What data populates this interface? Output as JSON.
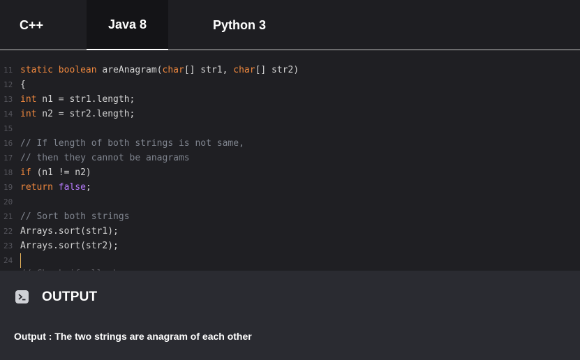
{
  "tabs": [
    {
      "label": "C++",
      "active": false
    },
    {
      "label": "Java 8",
      "active": true
    },
    {
      "label": "Python 3",
      "active": false
    }
  ],
  "editor": {
    "lines": [
      {
        "number": "11",
        "tokens": [
          {
            "t": "static boolean",
            "c": "kw"
          },
          {
            "t": " areAnagram(",
            "c": ""
          },
          {
            "t": "char",
            "c": "kw"
          },
          {
            "t": "[] str1, ",
            "c": ""
          },
          {
            "t": "char",
            "c": "kw"
          },
          {
            "t": "[] str2)",
            "c": ""
          }
        ]
      },
      {
        "number": "12",
        "tokens": [
          {
            "t": "{",
            "c": ""
          }
        ]
      },
      {
        "number": "13",
        "tokens": [
          {
            "t": "int",
            "c": "kw"
          },
          {
            "t": " n1 = str1.length;",
            "c": ""
          }
        ]
      },
      {
        "number": "14",
        "tokens": [
          {
            "t": "int",
            "c": "kw"
          },
          {
            "t": " n2 = str2.length;",
            "c": ""
          }
        ]
      },
      {
        "number": "15",
        "tokens": []
      },
      {
        "number": "16",
        "tokens": [
          {
            "t": "// If length of both strings is not same,",
            "c": "cm"
          }
        ]
      },
      {
        "number": "17",
        "tokens": [
          {
            "t": "// then they cannot be anagrams",
            "c": "cm"
          }
        ]
      },
      {
        "number": "18",
        "tokens": [
          {
            "t": "if",
            "c": "kw"
          },
          {
            "t": " (n1 != n2)",
            "c": ""
          }
        ]
      },
      {
        "number": "19",
        "tokens": [
          {
            "t": "return",
            "c": "kw"
          },
          {
            "t": " ",
            "c": ""
          },
          {
            "t": "false",
            "c": "bool"
          },
          {
            "t": ";",
            "c": ""
          }
        ]
      },
      {
        "number": "20",
        "tokens": []
      },
      {
        "number": "21",
        "tokens": [
          {
            "t": "// Sort both strings",
            "c": "cm"
          }
        ]
      },
      {
        "number": "22",
        "tokens": [
          {
            "t": "Arrays.sort(str1);",
            "c": ""
          }
        ]
      },
      {
        "number": "23",
        "tokens": [
          {
            "t": "Arrays.sort(str2);",
            "c": ""
          }
        ]
      },
      {
        "number": "24",
        "tokens": [],
        "cursor": true
      }
    ]
  },
  "output": {
    "icon": "terminal-icon",
    "title": "OUTPUT",
    "text": "Output : The two strings are anagram of each other"
  },
  "colors": {
    "keyword": "#f0883e",
    "boolean": "#b87cff",
    "comment": "#7f848e",
    "cursor": "#e5b25a"
  }
}
